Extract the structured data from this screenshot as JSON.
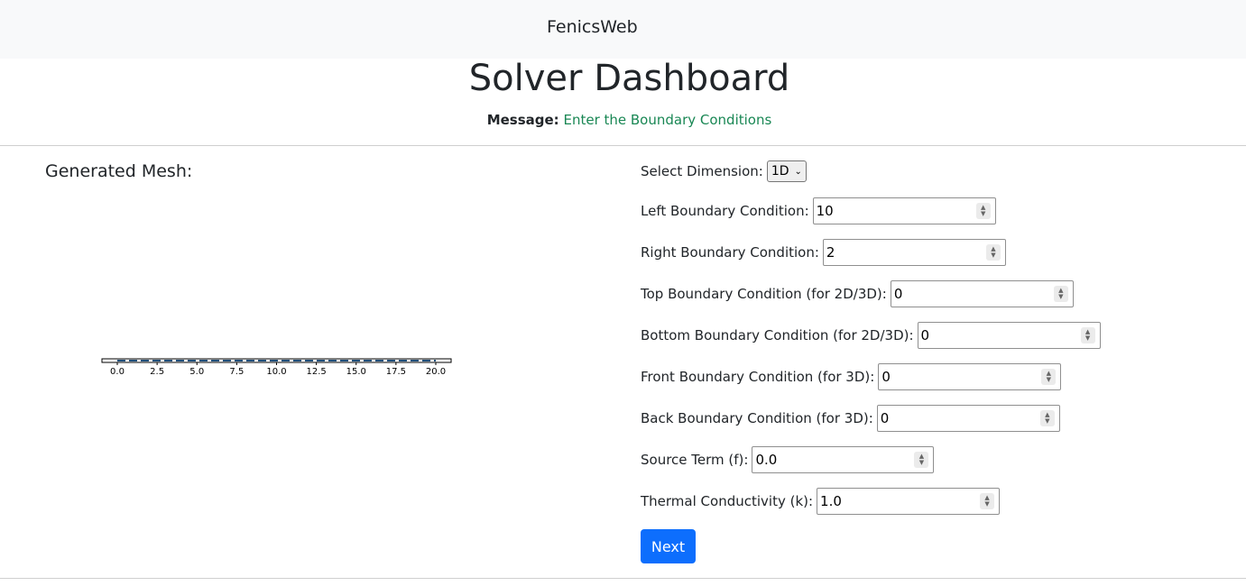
{
  "navbar": {
    "brand": "FenicsWeb"
  },
  "header": {
    "title": "Solver Dashboard",
    "message_label": "Message:",
    "message_text": "Enter the Boundary Conditions"
  },
  "mesh": {
    "title": "Generated Mesh:",
    "chart_data": {
      "type": "line",
      "xlim": [
        0,
        20
      ],
      "ticks": [
        "0.0",
        "2.5",
        "5.0",
        "7.5",
        "10.0",
        "12.5",
        "15.0",
        "17.5",
        "20.0"
      ],
      "line_color": "#1f4e79"
    }
  },
  "form": {
    "dimension": {
      "label": "Select Dimension:",
      "selected": "1D"
    },
    "left_bc": {
      "label": "Left Boundary Condition:",
      "value": "10"
    },
    "right_bc": {
      "label": "Right Boundary Condition:",
      "value": "2"
    },
    "top_bc": {
      "label": "Top Boundary Condition (for 2D/3D):",
      "value": "0"
    },
    "bottom_bc": {
      "label": "Bottom Boundary Condition (for 2D/3D):",
      "value": "0"
    },
    "front_bc": {
      "label": "Front Boundary Condition (for 3D):",
      "value": "0"
    },
    "back_bc": {
      "label": "Back Boundary Condition (for 3D):",
      "value": "0"
    },
    "source_term": {
      "label": "Source Term (f):",
      "value": "0.0"
    },
    "conductivity": {
      "label": "Thermal Conductivity (k):",
      "value": "1.0"
    },
    "next_label": "Next"
  },
  "colors": {
    "primary": "#0d6efd",
    "success": "#198754",
    "navbar_bg": "#f8f9fa"
  }
}
